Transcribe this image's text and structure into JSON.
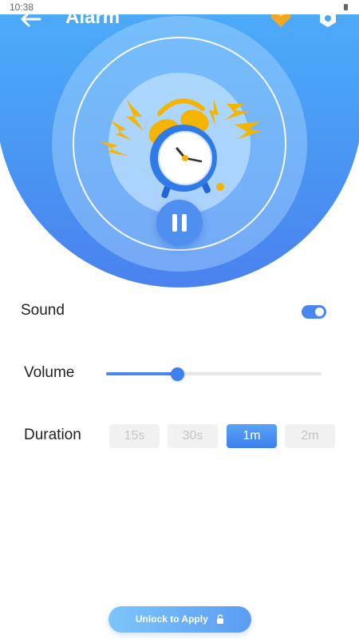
{
  "status_bar": {
    "time": "10:38"
  },
  "header": {
    "title": "Alarm",
    "back_icon": "arrow-left-icon",
    "gem_icon": "gem-icon",
    "settings_icon": "settings-hex-icon"
  },
  "hero": {
    "illustration": "alarm-clock-icon",
    "pause_icon": "pause-icon"
  },
  "colors": {
    "accent": "#4a86ee",
    "gradient_top": "#57b9fb",
    "gradient_bottom": "#4a82ee",
    "option_bg": "#f2f1f1"
  },
  "settings": {
    "sound": {
      "label": "Sound",
      "enabled": true
    },
    "volume": {
      "label": "Volume",
      "level": 0.33
    },
    "duration": {
      "label": "Duration",
      "options": [
        "15s",
        "30s",
        "1m",
        "2m"
      ],
      "selected": "1m"
    }
  },
  "footer": {
    "unlock_label": "Unlock to Apply",
    "lock_icon": "lock-icon"
  }
}
